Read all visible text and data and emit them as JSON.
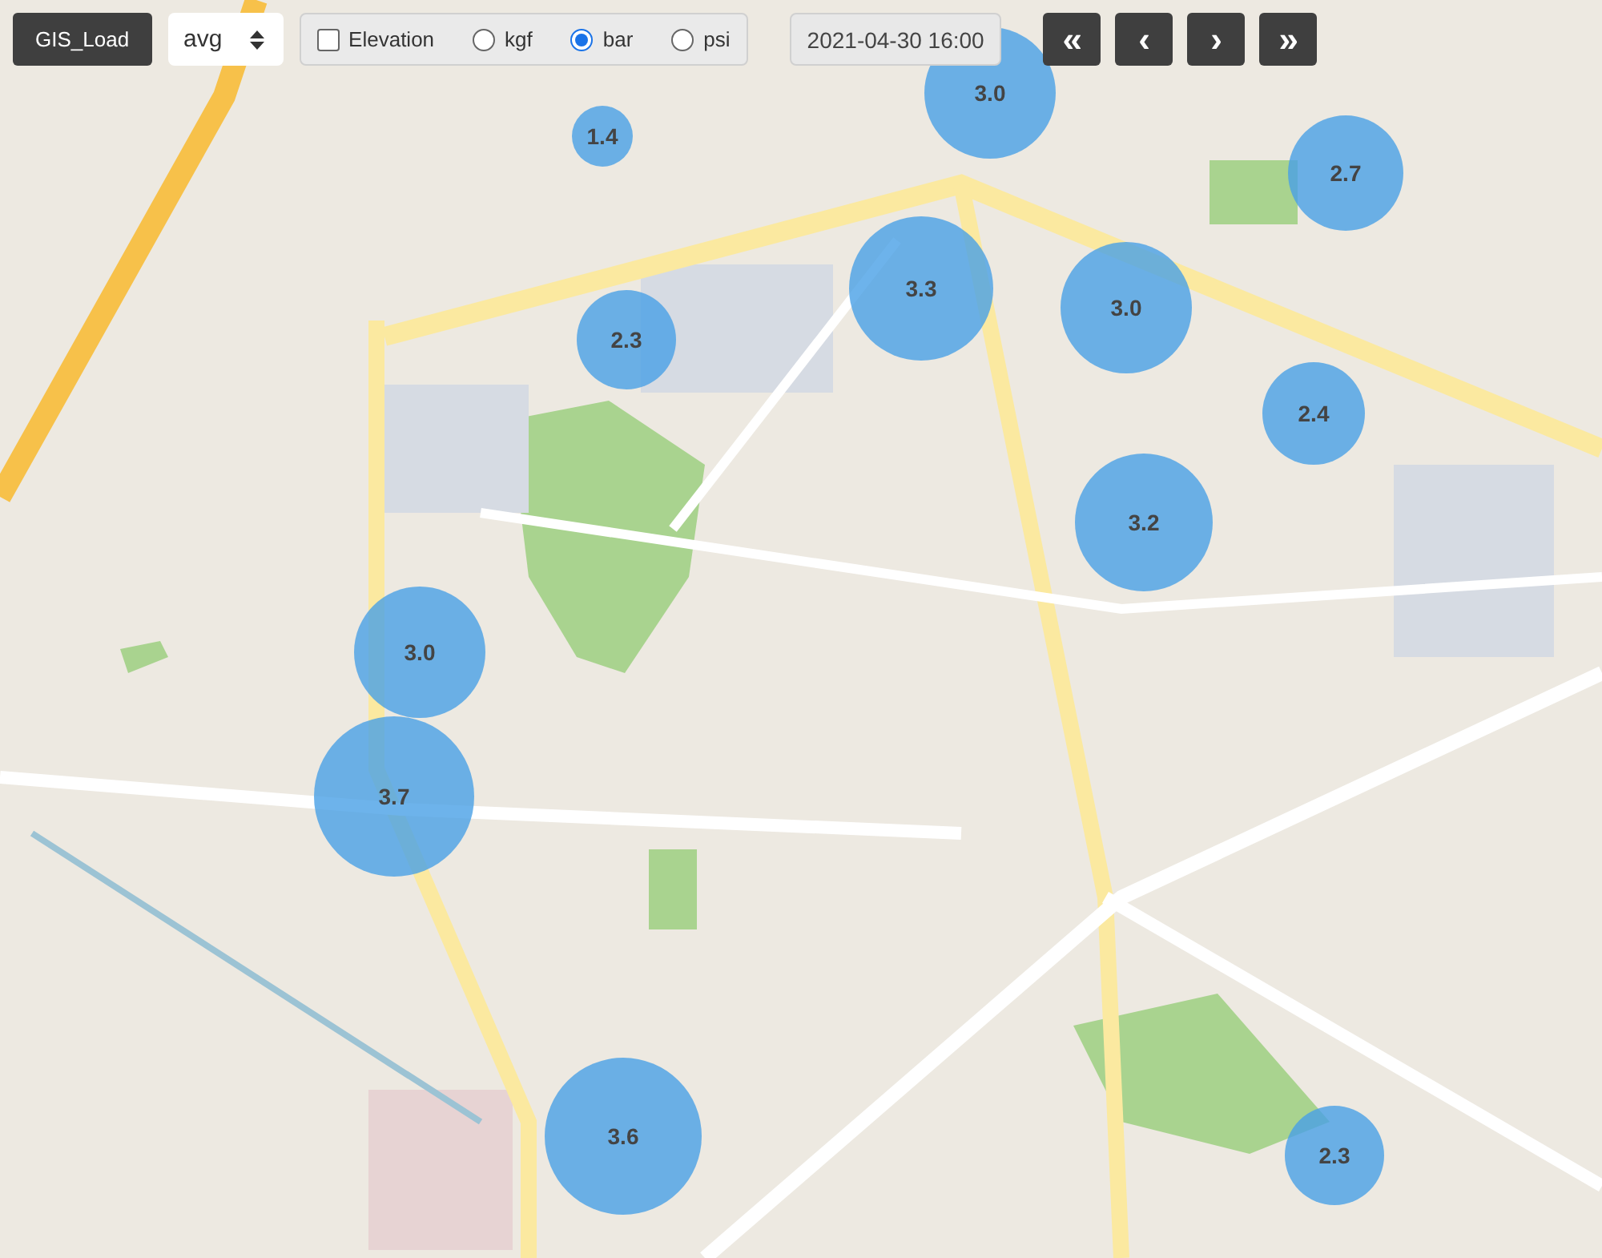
{
  "toolbar": {
    "load_button": "GIS_Load",
    "aggregate": "avg",
    "options": [
      {
        "kind": "checkbox",
        "label": "Elevation",
        "checked": false
      },
      {
        "kind": "radio",
        "label": "kgf",
        "selected": false
      },
      {
        "kind": "radio",
        "label": "bar",
        "selected": true
      },
      {
        "kind": "radio",
        "label": "psi",
        "selected": false
      }
    ],
    "datetime": "2021-04-30 16:00",
    "nav_buttons": [
      "«",
      "‹",
      "›",
      "»"
    ]
  },
  "map": {
    "markers": [
      {
        "value": "1.4"
      },
      {
        "value": "3.0"
      },
      {
        "value": "2.7"
      },
      {
        "value": "3.3"
      },
      {
        "value": "3.0"
      },
      {
        "value": "2.3"
      },
      {
        "value": "2.4"
      },
      {
        "value": "3.2"
      },
      {
        "value": "3.0"
      },
      {
        "value": "3.7"
      },
      {
        "value": "3.6"
      },
      {
        "value": "2.3"
      }
    ]
  }
}
